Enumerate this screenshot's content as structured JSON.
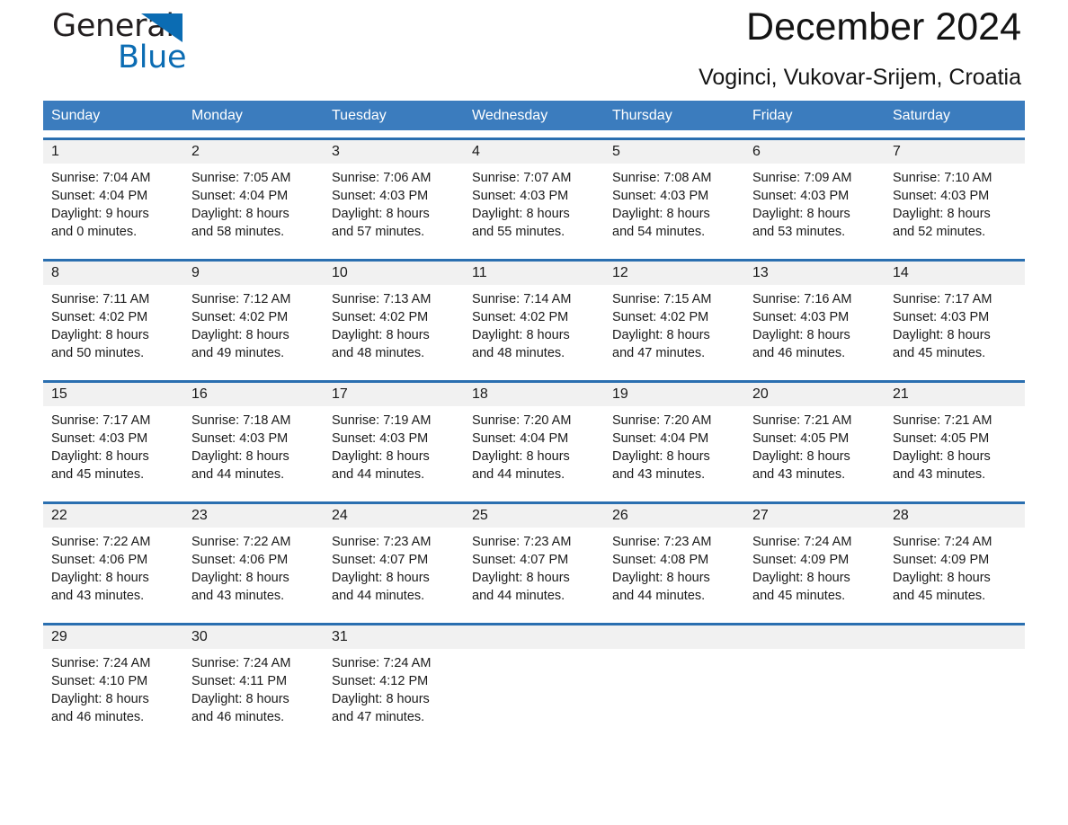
{
  "brand": {
    "name_part1": "General",
    "name_part2": "Blue",
    "accent_color": "#0b6cb3",
    "logo_icon": "triangle-flag-icon"
  },
  "header": {
    "title": "December 2024",
    "subtitle": "Voginci, Vukovar-Srijem, Croatia"
  },
  "calendar": {
    "header_color": "#3b7cbe",
    "row_divider_color": "#2a6fb0",
    "daynum_band_color": "#f1f1f1",
    "day_names": [
      "Sunday",
      "Monday",
      "Tuesday",
      "Wednesday",
      "Thursday",
      "Friday",
      "Saturday"
    ],
    "weeks": [
      [
        {
          "day": "1",
          "sunrise": "Sunrise: 7:04 AM",
          "sunset": "Sunset: 4:04 PM",
          "daylight1": "Daylight: 9 hours",
          "daylight2": "and 0 minutes."
        },
        {
          "day": "2",
          "sunrise": "Sunrise: 7:05 AM",
          "sunset": "Sunset: 4:04 PM",
          "daylight1": "Daylight: 8 hours",
          "daylight2": "and 58 minutes."
        },
        {
          "day": "3",
          "sunrise": "Sunrise: 7:06 AM",
          "sunset": "Sunset: 4:03 PM",
          "daylight1": "Daylight: 8 hours",
          "daylight2": "and 57 minutes."
        },
        {
          "day": "4",
          "sunrise": "Sunrise: 7:07 AM",
          "sunset": "Sunset: 4:03 PM",
          "daylight1": "Daylight: 8 hours",
          "daylight2": "and 55 minutes."
        },
        {
          "day": "5",
          "sunrise": "Sunrise: 7:08 AM",
          "sunset": "Sunset: 4:03 PM",
          "daylight1": "Daylight: 8 hours",
          "daylight2": "and 54 minutes."
        },
        {
          "day": "6",
          "sunrise": "Sunrise: 7:09 AM",
          "sunset": "Sunset: 4:03 PM",
          "daylight1": "Daylight: 8 hours",
          "daylight2": "and 53 minutes."
        },
        {
          "day": "7",
          "sunrise": "Sunrise: 7:10 AM",
          "sunset": "Sunset: 4:03 PM",
          "daylight1": "Daylight: 8 hours",
          "daylight2": "and 52 minutes."
        }
      ],
      [
        {
          "day": "8",
          "sunrise": "Sunrise: 7:11 AM",
          "sunset": "Sunset: 4:02 PM",
          "daylight1": "Daylight: 8 hours",
          "daylight2": "and 50 minutes."
        },
        {
          "day": "9",
          "sunrise": "Sunrise: 7:12 AM",
          "sunset": "Sunset: 4:02 PM",
          "daylight1": "Daylight: 8 hours",
          "daylight2": "and 49 minutes."
        },
        {
          "day": "10",
          "sunrise": "Sunrise: 7:13 AM",
          "sunset": "Sunset: 4:02 PM",
          "daylight1": "Daylight: 8 hours",
          "daylight2": "and 48 minutes."
        },
        {
          "day": "11",
          "sunrise": "Sunrise: 7:14 AM",
          "sunset": "Sunset: 4:02 PM",
          "daylight1": "Daylight: 8 hours",
          "daylight2": "and 48 minutes."
        },
        {
          "day": "12",
          "sunrise": "Sunrise: 7:15 AM",
          "sunset": "Sunset: 4:02 PM",
          "daylight1": "Daylight: 8 hours",
          "daylight2": "and 47 minutes."
        },
        {
          "day": "13",
          "sunrise": "Sunrise: 7:16 AM",
          "sunset": "Sunset: 4:03 PM",
          "daylight1": "Daylight: 8 hours",
          "daylight2": "and 46 minutes."
        },
        {
          "day": "14",
          "sunrise": "Sunrise: 7:17 AM",
          "sunset": "Sunset: 4:03 PM",
          "daylight1": "Daylight: 8 hours",
          "daylight2": "and 45 minutes."
        }
      ],
      [
        {
          "day": "15",
          "sunrise": "Sunrise: 7:17 AM",
          "sunset": "Sunset: 4:03 PM",
          "daylight1": "Daylight: 8 hours",
          "daylight2": "and 45 minutes."
        },
        {
          "day": "16",
          "sunrise": "Sunrise: 7:18 AM",
          "sunset": "Sunset: 4:03 PM",
          "daylight1": "Daylight: 8 hours",
          "daylight2": "and 44 minutes."
        },
        {
          "day": "17",
          "sunrise": "Sunrise: 7:19 AM",
          "sunset": "Sunset: 4:03 PM",
          "daylight1": "Daylight: 8 hours",
          "daylight2": "and 44 minutes."
        },
        {
          "day": "18",
          "sunrise": "Sunrise: 7:20 AM",
          "sunset": "Sunset: 4:04 PM",
          "daylight1": "Daylight: 8 hours",
          "daylight2": "and 44 minutes."
        },
        {
          "day": "19",
          "sunrise": "Sunrise: 7:20 AM",
          "sunset": "Sunset: 4:04 PM",
          "daylight1": "Daylight: 8 hours",
          "daylight2": "and 43 minutes."
        },
        {
          "day": "20",
          "sunrise": "Sunrise: 7:21 AM",
          "sunset": "Sunset: 4:05 PM",
          "daylight1": "Daylight: 8 hours",
          "daylight2": "and 43 minutes."
        },
        {
          "day": "21",
          "sunrise": "Sunrise: 7:21 AM",
          "sunset": "Sunset: 4:05 PM",
          "daylight1": "Daylight: 8 hours",
          "daylight2": "and 43 minutes."
        }
      ],
      [
        {
          "day": "22",
          "sunrise": "Sunrise: 7:22 AM",
          "sunset": "Sunset: 4:06 PM",
          "daylight1": "Daylight: 8 hours",
          "daylight2": "and 43 minutes."
        },
        {
          "day": "23",
          "sunrise": "Sunrise: 7:22 AM",
          "sunset": "Sunset: 4:06 PM",
          "daylight1": "Daylight: 8 hours",
          "daylight2": "and 43 minutes."
        },
        {
          "day": "24",
          "sunrise": "Sunrise: 7:23 AM",
          "sunset": "Sunset: 4:07 PM",
          "daylight1": "Daylight: 8 hours",
          "daylight2": "and 44 minutes."
        },
        {
          "day": "25",
          "sunrise": "Sunrise: 7:23 AM",
          "sunset": "Sunset: 4:07 PM",
          "daylight1": "Daylight: 8 hours",
          "daylight2": "and 44 minutes."
        },
        {
          "day": "26",
          "sunrise": "Sunrise: 7:23 AM",
          "sunset": "Sunset: 4:08 PM",
          "daylight1": "Daylight: 8 hours",
          "daylight2": "and 44 minutes."
        },
        {
          "day": "27",
          "sunrise": "Sunrise: 7:24 AM",
          "sunset": "Sunset: 4:09 PM",
          "daylight1": "Daylight: 8 hours",
          "daylight2": "and 45 minutes."
        },
        {
          "day": "28",
          "sunrise": "Sunrise: 7:24 AM",
          "sunset": "Sunset: 4:09 PM",
          "daylight1": "Daylight: 8 hours",
          "daylight2": "and 45 minutes."
        }
      ],
      [
        {
          "day": "29",
          "sunrise": "Sunrise: 7:24 AM",
          "sunset": "Sunset: 4:10 PM",
          "daylight1": "Daylight: 8 hours",
          "daylight2": "and 46 minutes."
        },
        {
          "day": "30",
          "sunrise": "Sunrise: 7:24 AM",
          "sunset": "Sunset: 4:11 PM",
          "daylight1": "Daylight: 8 hours",
          "daylight2": "and 46 minutes."
        },
        {
          "day": "31",
          "sunrise": "Sunrise: 7:24 AM",
          "sunset": "Sunset: 4:12 PM",
          "daylight1": "Daylight: 8 hours",
          "daylight2": "and 47 minutes."
        },
        {
          "day": "",
          "sunrise": "",
          "sunset": "",
          "daylight1": "",
          "daylight2": ""
        },
        {
          "day": "",
          "sunrise": "",
          "sunset": "",
          "daylight1": "",
          "daylight2": ""
        },
        {
          "day": "",
          "sunrise": "",
          "sunset": "",
          "daylight1": "",
          "daylight2": ""
        },
        {
          "day": "",
          "sunrise": "",
          "sunset": "",
          "daylight1": "",
          "daylight2": ""
        }
      ]
    ]
  }
}
